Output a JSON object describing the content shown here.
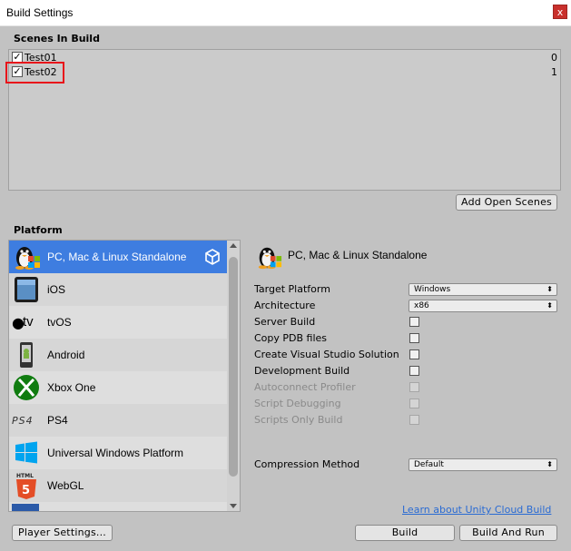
{
  "window": {
    "title": "Build Settings",
    "close_label": "x"
  },
  "scenes": {
    "heading": "Scenes In Build",
    "items": [
      {
        "name": "Test01",
        "index": "0",
        "checked": true
      },
      {
        "name": "Test02",
        "index": "1",
        "checked": true
      }
    ],
    "add_open_scenes_label": "Add Open Scenes"
  },
  "platform": {
    "heading": "Platform",
    "items": [
      {
        "name": "PC, Mac & Linux Standalone",
        "icon": "linux-penguin-icon",
        "selected": true
      },
      {
        "name": "iOS",
        "icon": "ipad-icon"
      },
      {
        "name": "tvOS",
        "icon": "apple-tv-icon",
        "icon_text": "tv"
      },
      {
        "name": "Android",
        "icon": "android-phone-icon"
      },
      {
        "name": "Xbox One",
        "icon": "xbox-icon"
      },
      {
        "name": "PS4",
        "icon": "ps4-logo-icon",
        "icon_text": "PS4"
      },
      {
        "name": "Universal Windows Platform",
        "icon": "windows-logo-icon"
      },
      {
        "name": "WebGL",
        "icon": "html5-icon",
        "icon_text": "HTML"
      }
    ]
  },
  "settings": {
    "title": "PC, Mac & Linux Standalone",
    "target_platform": {
      "label": "Target Platform",
      "value": "Windows"
    },
    "architecture": {
      "label": "Architecture",
      "value": "x86"
    },
    "server_build": "Server Build",
    "copy_pdb": "Copy PDB files",
    "create_vs": "Create Visual Studio Solution",
    "development_build": "Development Build",
    "autoconnect_profiler": "Autoconnect Profiler",
    "script_debugging": "Script Debugging",
    "scripts_only": "Scripts Only Build",
    "compression": {
      "label": "Compression Method",
      "value": "Default"
    }
  },
  "footer": {
    "cloud_link": "Learn about Unity Cloud Build",
    "player_settings": "Player Settings...",
    "build": "Build",
    "build_and_run": "Build And Run"
  },
  "colors": {
    "selection": "#3e7de0",
    "highlight_box": "#e8141a",
    "link": "#2a6bd3"
  }
}
